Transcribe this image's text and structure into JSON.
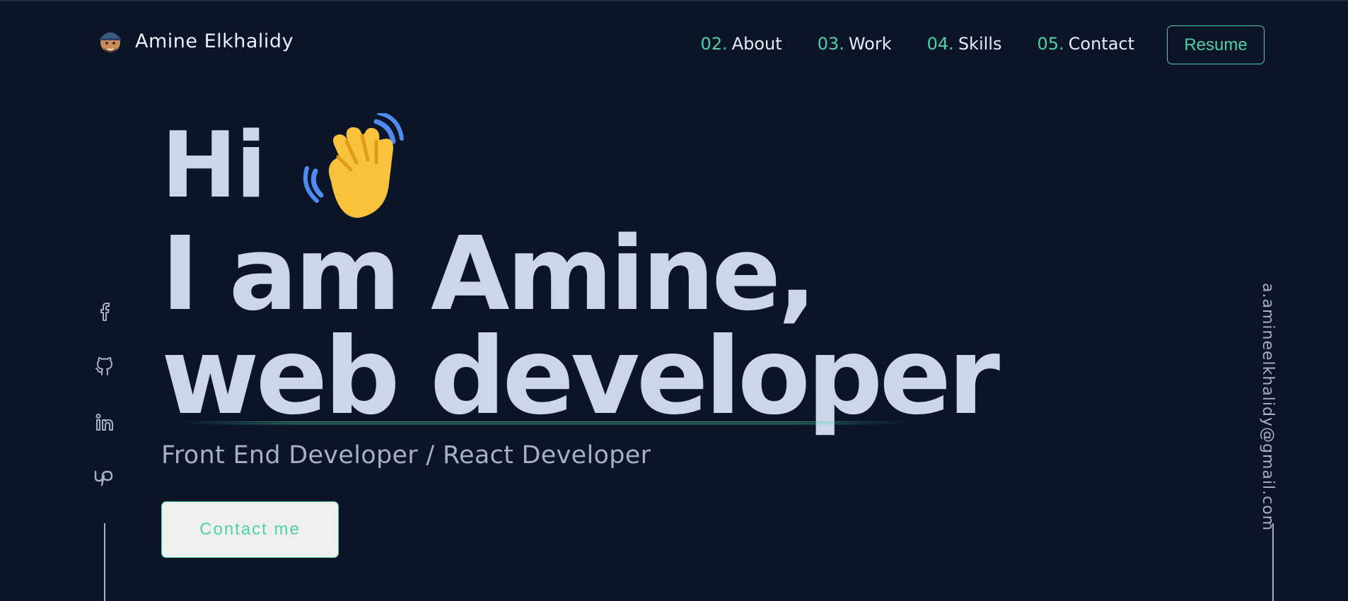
{
  "header": {
    "brand_name": "Amine Elkhalidy",
    "avatar": "memoji-avatar",
    "nav": [
      {
        "num": "02.",
        "label": "About"
      },
      {
        "num": "03.",
        "label": "Work"
      },
      {
        "num": "04.",
        "label": "Skills"
      },
      {
        "num": "05.",
        "label": "Contact"
      }
    ],
    "resume_label": "Resume"
  },
  "hero": {
    "greeting": "Hi",
    "wave_icon": "waving-hand-icon",
    "line2": "I am Amine,",
    "line3": "web developer",
    "subtitle": "Front End Developer / React Developer",
    "cta_label": "Contact me"
  },
  "social": [
    {
      "icon": "facebook-icon"
    },
    {
      "icon": "github-icon"
    },
    {
      "icon": "linkedin-icon"
    },
    {
      "icon": "upwork-icon"
    }
  ],
  "email": "a.amineelkhalidy@gmail.com",
  "colors": {
    "background": "#0b1527",
    "accent": "#4fd1a5",
    "heading": "#ccd6e6",
    "muted": "#a2b1c6"
  }
}
